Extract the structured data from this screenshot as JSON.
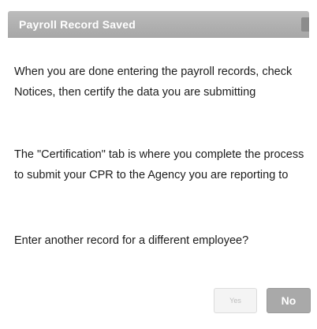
{
  "dialog": {
    "title": "Payroll Record Saved",
    "messages": [
      "When you are done entering the payroll records, check Notices, then certify the data you are submitting",
      "The \"Certification\" tab is where you complete the process to submit your CPR to the Agency you are reporting to",
      "Enter another record for a different employee?"
    ],
    "buttons": {
      "yes_label": "Yes",
      "no_label": "No"
    }
  }
}
